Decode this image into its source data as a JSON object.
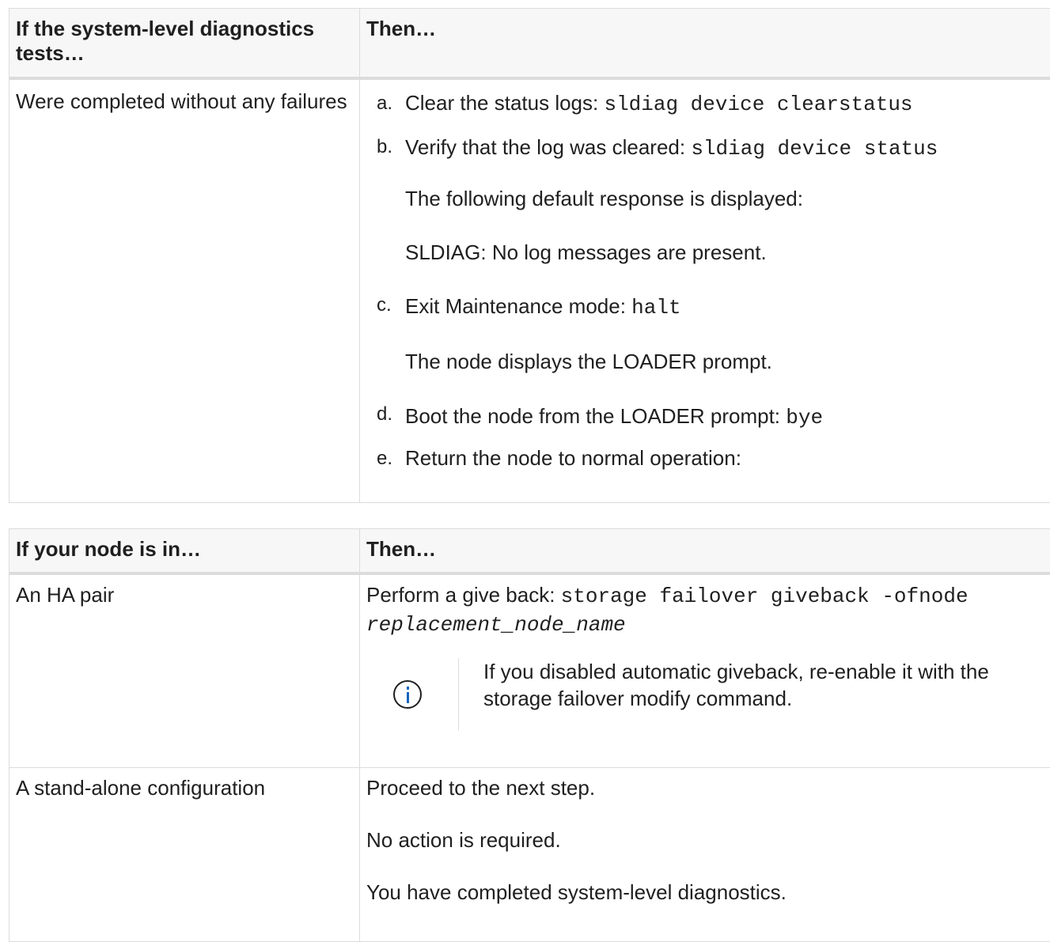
{
  "table1": {
    "header": {
      "col1": "If the system-level diagnostics tests…",
      "col2": "Then…"
    },
    "row": {
      "condition": "Were completed without any failures",
      "steps": [
        {
          "letter": "a.",
          "text": "Clear the status logs: ",
          "code": "sldiag device clearstatus"
        },
        {
          "letter": "b.",
          "text": "Verify that the log was cleared: ",
          "code": "sldiag device status"
        },
        {
          "letter": "c.",
          "text": "Exit Maintenance mode: ",
          "code": "halt"
        },
        {
          "letter": "d.",
          "text": "Boot the node from the LOADER prompt: ",
          "code": "bye"
        },
        {
          "letter": "e.",
          "text": "Return the node to normal operation:",
          "code": ""
        }
      ],
      "b_para1": "The following default response is displayed:",
      "b_para2": "SLDIAG: No log messages are present.",
      "c_para1": "The node displays the LOADER prompt."
    }
  },
  "table2": {
    "header": {
      "col1": "If your node is in…",
      "col2": "Then…"
    },
    "rows": [
      {
        "condition": "An HA pair",
        "text": "Perform a give back: ",
        "code": "storage failover giveback -ofnode",
        "code_italic": "replacement_node_name",
        "note": "If you disabled automatic giveback, re-enable it with the storage failover modify command.",
        "note_icon": "info-icon"
      },
      {
        "condition": "A stand-alone configuration",
        "paras": [
          "Proceed to the next step.",
          "No action is required.",
          "You have completed system-level diagnostics."
        ]
      }
    ]
  },
  "colors": {
    "border": "#dcdcdc",
    "header_bg": "#f7f7f7",
    "text": "#1f1f1f",
    "icon_accent": "#1565c0"
  }
}
